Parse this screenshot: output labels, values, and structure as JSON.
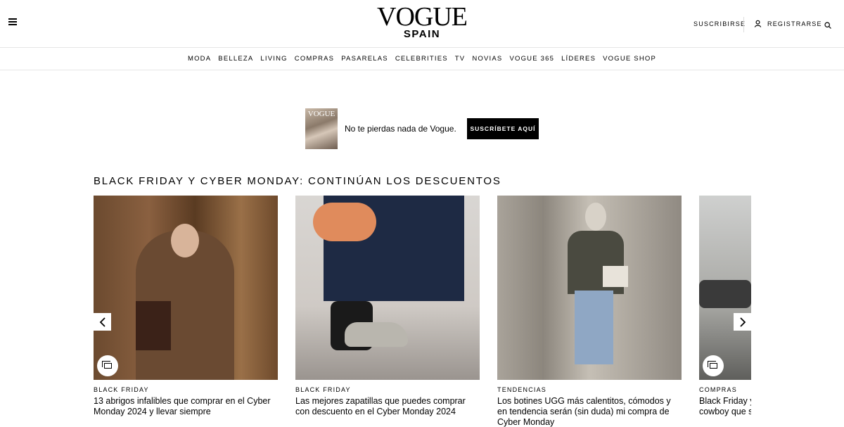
{
  "header": {
    "logo_main": "VOGUE",
    "logo_sub": "SPAIN",
    "subscribe": "SUSCRIBIRSE",
    "register": "REGISTRARSE"
  },
  "nav": [
    "MODA",
    "BELLEZA",
    "LIVING",
    "COMPRAS",
    "PASARELAS",
    "CELEBRITIES",
    "TV",
    "NOVIAS",
    "VOGUE 365",
    "LÍDERES",
    "VOGUE SHOP"
  ],
  "promo": {
    "cover_logo": "VOGUE",
    "text": "No te pierdas nada de Vogue.",
    "button": "SUSCRÍBETE AQUÍ"
  },
  "section": {
    "title": "BLACK FRIDAY Y CYBER MONDAY: CONTINÚAN LOS DESCUENTOS"
  },
  "cards": [
    {
      "tag": "BLACK FRIDAY",
      "title": "13 abrigos infalibles que comprar en el Cyber Monday 2024 y llevar siempre"
    },
    {
      "tag": "BLACK FRIDAY",
      "title": "Las mejores zapatillas que puedes comprar con descuento en el Cyber Monday 2024"
    },
    {
      "tag": "TENDENCIAS",
      "title": "Los botines UGG más calentitos, cómodos y en tendencia serán (sin duda) mi compra de Cyber Monday"
    },
    {
      "tag": "COMPRAS",
      "title": "Black Friday y Cyber Monday: botines de cowboy que son una buena inversión"
    }
  ],
  "colors": {
    "brand": "#000000",
    "border": "#e6e6e6"
  }
}
